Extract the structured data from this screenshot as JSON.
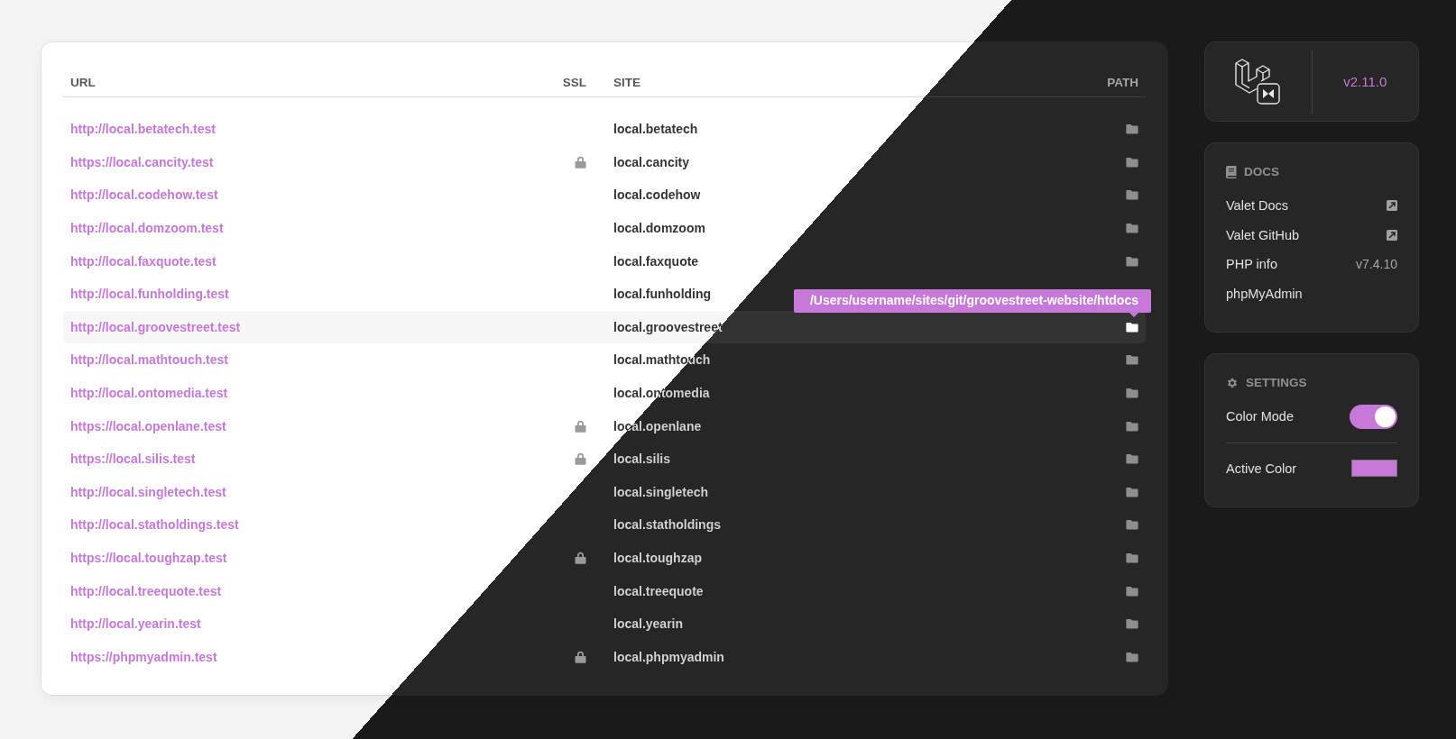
{
  "table": {
    "columns": [
      "URL",
      "SSL",
      "SITE",
      "PATH"
    ],
    "rows": [
      {
        "url": "http://local.betatech.test",
        "ssl": false,
        "site": "local.betatech",
        "highlighted": false
      },
      {
        "url": "https://local.cancity.test",
        "ssl": true,
        "site": "local.cancity",
        "highlighted": false
      },
      {
        "url": "http://local.codehow.test",
        "ssl": false,
        "site": "local.codehow",
        "highlighted": false
      },
      {
        "url": "http://local.domzoom.test",
        "ssl": false,
        "site": "local.domzoom",
        "highlighted": false
      },
      {
        "url": "http://local.faxquote.test",
        "ssl": false,
        "site": "local.faxquote",
        "highlighted": false
      },
      {
        "url": "http://local.funholding.test",
        "ssl": false,
        "site": "local.funholding",
        "highlighted": false
      },
      {
        "url": "http://local.groovestreet.test",
        "ssl": false,
        "site": "local.groovestreet",
        "highlighted": true,
        "tooltip": "/Users/username/sites/git/groovestreet-website/htdocs"
      },
      {
        "url": "http://local.mathtouch.test",
        "ssl": false,
        "site": "local.mathtouch",
        "highlighted": false
      },
      {
        "url": "http://local.ontomedia.test",
        "ssl": false,
        "site": "local.ontomedia",
        "highlighted": false
      },
      {
        "url": "https://local.openlane.test",
        "ssl": true,
        "site": "local.openlane",
        "highlighted": false
      },
      {
        "url": "https://local.silis.test",
        "ssl": true,
        "site": "local.silis",
        "highlighted": false
      },
      {
        "url": "http://local.singletech.test",
        "ssl": false,
        "site": "local.singletech",
        "highlighted": false
      },
      {
        "url": "http://local.statholdings.test",
        "ssl": false,
        "site": "local.statholdings",
        "highlighted": false
      },
      {
        "url": "https://local.toughzap.test",
        "ssl": true,
        "site": "local.toughzap",
        "highlighted": false
      },
      {
        "url": "http://local.treequote.test",
        "ssl": false,
        "site": "local.treequote",
        "highlighted": false
      },
      {
        "url": "http://local.yearin.test",
        "ssl": false,
        "site": "local.yearin",
        "highlighted": false
      },
      {
        "url": "https://phpmyadmin.test",
        "ssl": true,
        "site": "local.phpmyadmin",
        "highlighted": false
      }
    ]
  },
  "version": "v2.11.0",
  "docs": {
    "title": "DOCS",
    "items": [
      {
        "kind": "link",
        "label": "Valet Docs"
      },
      {
        "kind": "link",
        "label": "Valet GitHub"
      },
      {
        "kind": "value",
        "label": "PHP info",
        "value": "v7.4.10"
      },
      {
        "kind": "plain",
        "label": "phpMyAdmin"
      }
    ]
  },
  "settings": {
    "title": "SETTINGS",
    "items": [
      {
        "kind": "toggle",
        "label": "Color Mode",
        "on": true
      },
      {
        "kind": "color",
        "label": "Active Color",
        "color": "#c779da"
      }
    ]
  }
}
